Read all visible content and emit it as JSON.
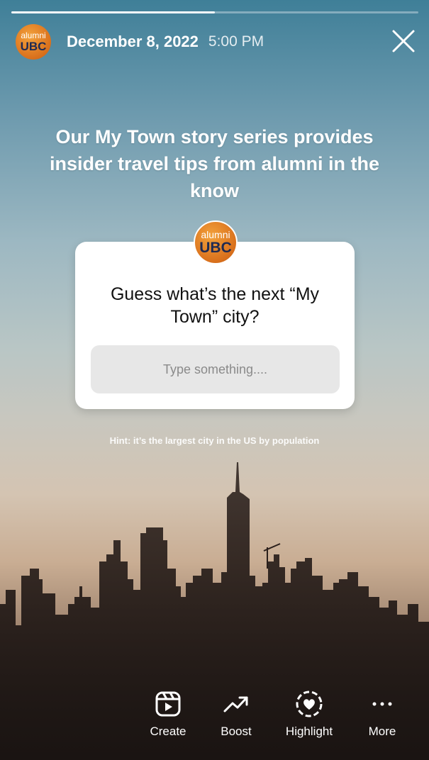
{
  "story": {
    "progress_fraction": 0.5,
    "account_avatar": {
      "line1": "alumni",
      "line2": "UBC"
    },
    "date": "December 8, 2022",
    "time": "5:00 PM",
    "close_icon": "close-icon"
  },
  "headline": "Our My Town story series provides insider travel tips from alumni in the know",
  "question_sticker": {
    "avatar": {
      "line1": "alumni",
      "line2": "UBC"
    },
    "question": "Guess what’s the next “My Town” city?",
    "placeholder": "Type something...."
  },
  "hint": "Hint: it’s the largest city in the US by population",
  "toolbar": {
    "items": [
      {
        "label": "Create",
        "icon": "reels-icon"
      },
      {
        "label": "Boost",
        "icon": "trending-up-icon"
      },
      {
        "label": "Highlight",
        "icon": "highlight-heart-icon"
      },
      {
        "label": "More",
        "icon": "more-dots-icon"
      }
    ]
  },
  "colors": {
    "avatar_orange": "#d9701c",
    "avatar_navy": "#1e2a52"
  }
}
